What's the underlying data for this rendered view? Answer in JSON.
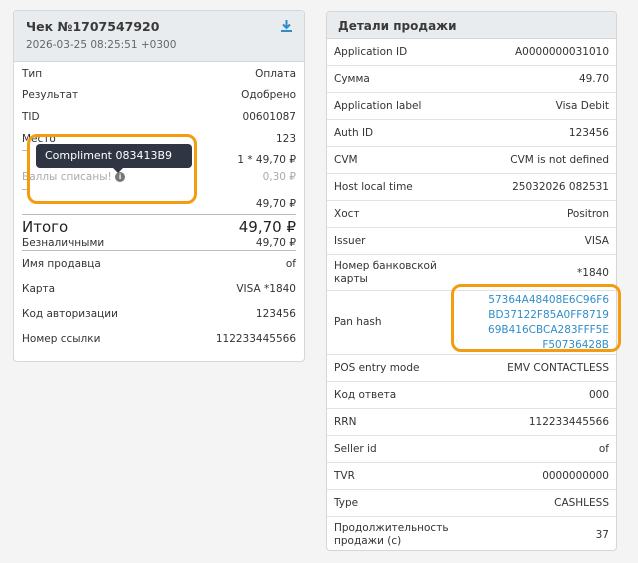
{
  "receipt": {
    "title": "Чек №1707547920",
    "date": "2026-03-25 08:25:51 +0300",
    "rows": [
      {
        "k": "Тип",
        "v": "Оплата"
      },
      {
        "k": "Результат",
        "v": "Одобрено"
      },
      {
        "k": "TID",
        "v": "00601087"
      },
      {
        "k": "Место",
        "v": "123"
      }
    ],
    "item_line": "1 * 49,70 ₽",
    "points_label": "Баллы списаны!",
    "points_value": "0,30 ₽",
    "subtotal": "49,70 ₽",
    "total_label": "Итого",
    "total_value": "49,70 ₽",
    "cashless_label": "Безналичными",
    "cashless_value": "49,70 ₽",
    "rows2": [
      {
        "k": "Имя продавца",
        "v": "of"
      },
      {
        "k": "Карта",
        "v": "VISA *1840"
      },
      {
        "k": "Код авторизации",
        "v": "123456"
      },
      {
        "k": "Номер ссылки",
        "v": "112233445566"
      }
    ],
    "tooltip": "Compliment 083413B9",
    "icons": {
      "download": "download-icon",
      "info": "info-icon"
    }
  },
  "details": {
    "title": "Детали продажи",
    "rows": [
      {
        "k": "Application ID",
        "v": "A0000000031010"
      },
      {
        "k": "Сумма",
        "v": "49.70"
      },
      {
        "k": "Application label",
        "v": "Visa Debit"
      },
      {
        "k": "Auth ID",
        "v": "123456"
      },
      {
        "k": "CVM",
        "v": "CVM is not defined"
      },
      {
        "k": "Host local time",
        "v": "25032026 082531"
      },
      {
        "k": "Хост",
        "v": "Positron"
      },
      {
        "k": "Issuer",
        "v": "VISA"
      },
      {
        "k": "Номер банковской карты",
        "v": "*1840"
      },
      {
        "k": "Pan hash",
        "v": "57364A48408E6C96F6BD37122F85A0FF871969B416CBCA283FFF5EF50736428B"
      },
      {
        "k": "POS entry mode",
        "v": "EMV CONTACTLESS"
      },
      {
        "k": "Код ответа",
        "v": "000"
      },
      {
        "k": "RRN",
        "v": "112233445566"
      },
      {
        "k": "Seller id",
        "v": "of"
      },
      {
        "k": "TVR",
        "v": "0000000000"
      },
      {
        "k": "Type",
        "v": "CASHLESS"
      },
      {
        "k": "Продолжительность продажи (с)",
        "v": "37"
      }
    ],
    "hash_lines": [
      "57364A48408E6C96F6",
      "BD37122F85A0FF8719",
      "69B416CBCA283FFF5E",
      "F50736428B"
    ]
  },
  "colors": {
    "highlight": "#f39c12",
    "link": "#2f8ec9",
    "tooltip_bg": "#2f3542"
  }
}
